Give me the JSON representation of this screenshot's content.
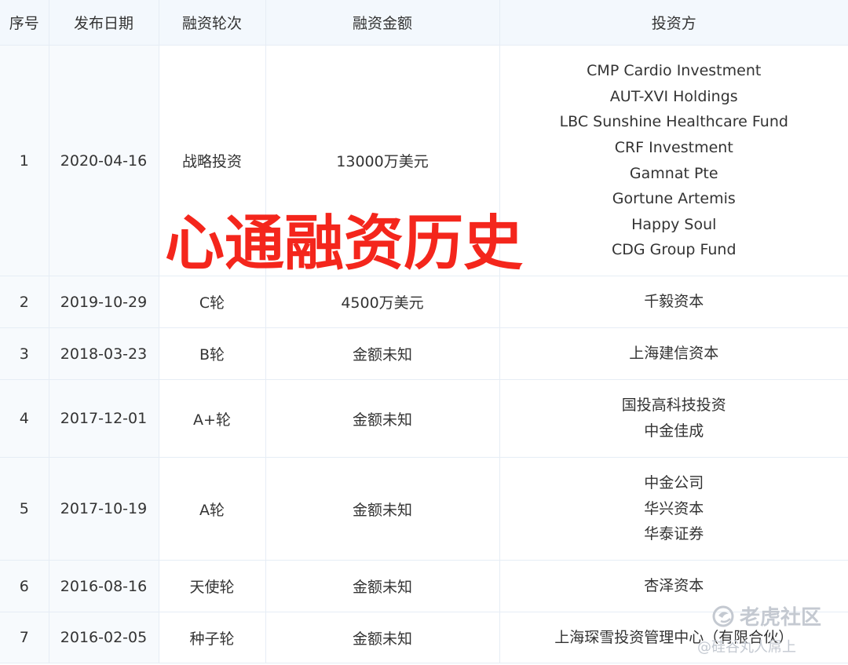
{
  "table": {
    "headers": [
      "序号",
      "发布日期",
      "融资轮次",
      "融资金额",
      "投资方"
    ],
    "rows": [
      {
        "index": "1",
        "date": "2020-04-16",
        "round": "战略投资",
        "amount": "13000万美元",
        "investors": [
          "CMP Cardio Investment",
          "AUT-XVI Holdings",
          "LBC Sunshine Healthcare Fund",
          "CRF Investment",
          "Gamnat Pte",
          "Gortune Artemis",
          "Happy Soul",
          "CDG Group Fund"
        ]
      },
      {
        "index": "2",
        "date": "2019-10-29",
        "round": "C轮",
        "amount": "4500万美元",
        "investors": [
          "千毅资本"
        ]
      },
      {
        "index": "3",
        "date": "2018-03-23",
        "round": "B轮",
        "amount": "金额未知",
        "investors": [
          "上海建信资本"
        ]
      },
      {
        "index": "4",
        "date": "2017-12-01",
        "round": "A+轮",
        "amount": "金额未知",
        "investors": [
          "国投高科技投资",
          "中金佳成"
        ]
      },
      {
        "index": "5",
        "date": "2017-10-19",
        "round": "A轮",
        "amount": "金额未知",
        "investors": [
          "中金公司",
          "华兴资本",
          "华泰证券"
        ]
      },
      {
        "index": "6",
        "date": "2016-08-16",
        "round": "天使轮",
        "amount": "金额未知",
        "investors": [
          "杏泽资本"
        ]
      },
      {
        "index": "7",
        "date": "2016-02-05",
        "round": "种子轮",
        "amount": "金额未知",
        "investors": [
          "上海琛雪投资管理中心（有限合伙）"
        ]
      }
    ]
  },
  "overlay": {
    "title": "心通融资历史",
    "title_color": "#f4261c"
  },
  "watermark": {
    "brand": "老虎社区",
    "user": "@硅谷丸人屌上",
    "icon": "tiger-community-logo-icon"
  },
  "colors": {
    "header_bg": "#f3f8fd",
    "border": "#e6edf5",
    "text": "#333333"
  }
}
